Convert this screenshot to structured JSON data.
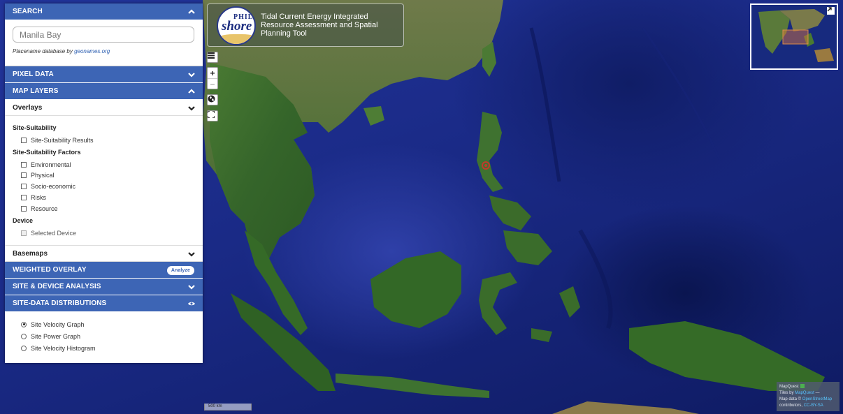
{
  "app": {
    "title": "Tidal Current Energy Integrated Resource Assessment and Spatial Planning Tool",
    "logo_text_top": "PHIL",
    "logo_text_main": "shore"
  },
  "panel": {
    "search": {
      "header": "SEARCH",
      "value": "Manila Bay",
      "attribution_prefix": "Placename database by ",
      "attribution_link": "geonames.org"
    },
    "pixel_data": {
      "header": "PIXEL DATA"
    },
    "map_layers": {
      "header": "MAP LAYERS",
      "overlays": {
        "label": "Overlays",
        "groups": [
          {
            "title": "Site-Suitability",
            "items": [
              "Site-Suitability Results"
            ]
          },
          {
            "title": "Site-Suitability Factors",
            "items": [
              "Environmental",
              "Physical",
              "Socio-economic",
              "Risks",
              "Resource"
            ]
          },
          {
            "title": "Device",
            "items": [
              "Selected Device"
            ]
          }
        ]
      },
      "basemaps": {
        "label": "Basemaps"
      }
    },
    "weighted_overlay": {
      "header": "WEIGHTED OVERLAY",
      "button": "Analyze"
    },
    "site_device_analysis": {
      "header": "SITE & DEVICE ANALYSIS"
    },
    "site_data_distributions": {
      "header": "SITE-DATA DISTRIBUTIONS",
      "options": [
        "Site Velocity Graph",
        "Site Power Graph",
        "Site Velocity Histogram"
      ],
      "selected": "Site Velocity Graph"
    }
  },
  "map": {
    "zoom_in": "+",
    "zoom_out": "–",
    "scale_label": "500 km",
    "attribution": {
      "line1": "MapQuest",
      "line2_prefix": "Tiles by ",
      "line2_link": "MapQuest",
      "line2_suffix": " —",
      "line3_prefix": "Map data © ",
      "line3_link": "OpenStreetMap",
      "line4_prefix": "contributors, ",
      "line4_link": "CC-BY-SA"
    },
    "marker_color": "#c0392b"
  },
  "colors": {
    "header_blue": "#3d65b5",
    "ocean_blue": "#1f3190",
    "land_green": "#3e6f2a"
  }
}
